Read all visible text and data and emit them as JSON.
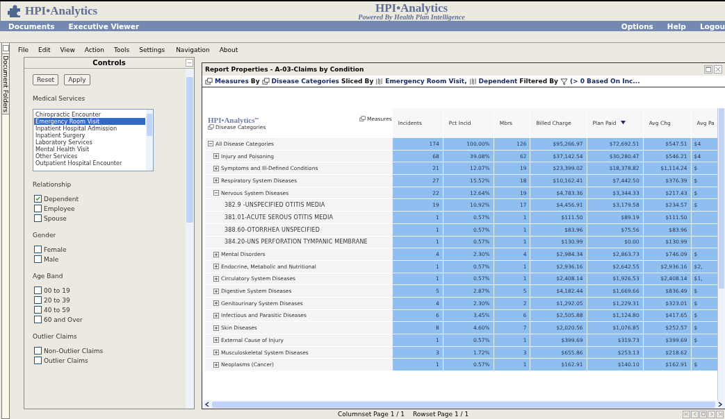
{
  "header": {
    "logo": "HPI•Analytics",
    "title": "HPI•Analytics",
    "subtitle": "Powered By Health Plan Intelligence"
  },
  "nav_left": [
    "Documents",
    "Executive Viewer"
  ],
  "nav_right": [
    "Options",
    "Help",
    "Logou"
  ],
  "side_tab": "Document Folders",
  "menu": [
    "File",
    "Edit",
    "View",
    "Action",
    "Tools",
    "Settings",
    "Navigation",
    "About"
  ],
  "controls": {
    "title": "Controls",
    "buttons": [
      "Reset",
      "Apply"
    ],
    "medical_services": {
      "label": "Medical Services",
      "items": [
        {
          "text": "Chiropractic Encounter",
          "selected": false
        },
        {
          "text": "Emergency Room Visit",
          "selected": true
        },
        {
          "text": "Inpatient Hospital Admission",
          "selected": false
        },
        {
          "text": "Inpatient Surgery",
          "selected": false
        },
        {
          "text": "Laboratory Services",
          "selected": false
        },
        {
          "text": "Mental Health Visit",
          "selected": false
        },
        {
          "text": "Other Services",
          "selected": false
        },
        {
          "text": "Outpatient Hospital Encounter",
          "selected": false
        }
      ]
    },
    "groups": [
      {
        "label": "Relationship",
        "options": [
          {
            "text": "Dependent",
            "checked": true
          },
          {
            "text": "Employee",
            "checked": false
          },
          {
            "text": "Spouse",
            "checked": false
          }
        ]
      },
      {
        "label": "Gender",
        "options": [
          {
            "text": "Female",
            "checked": false
          },
          {
            "text": "Male",
            "checked": false
          }
        ]
      },
      {
        "label": "Age Band",
        "options": [
          {
            "text": "00 to 19",
            "checked": false
          },
          {
            "text": "20 to 39",
            "checked": false
          },
          {
            "text": "40 to 59",
            "checked": false
          },
          {
            "text": "60 and Over",
            "checked": false
          }
        ]
      },
      {
        "label": "Outlier Claims",
        "options": [
          {
            "text": "Non-Outlier Claims",
            "checked": false
          },
          {
            "text": "Outlier Claims",
            "checked": false
          }
        ]
      }
    ]
  },
  "report": {
    "title": "Report Properties - A-03-Claims by Condition",
    "breadcrumb": [
      {
        "kind": "icon-link",
        "text": "Measures"
      },
      {
        "kind": "plain",
        "text": "By"
      },
      {
        "kind": "icon-link",
        "text": "Disease Categories"
      },
      {
        "kind": "plain",
        "text": "Sliced By"
      },
      {
        "kind": "slice-link",
        "text": "Emergency Room Visit,"
      },
      {
        "kind": "slice-link",
        "text": "Dependent"
      },
      {
        "kind": "plain",
        "text": "Filtered By"
      },
      {
        "kind": "filter-link",
        "text": "(> 0 Based On Inc..."
      }
    ],
    "corner": {
      "logo": "HPI•Analytics",
      "mark": "tm",
      "measures": "Measures",
      "rows": "Disease Categories"
    },
    "columns": [
      {
        "label": "Incidents"
      },
      {
        "label": "Pct Incid"
      },
      {
        "label": "Mbrs"
      },
      {
        "label": "Billed Charge"
      },
      {
        "label": "Plan Paid",
        "sorted": true
      },
      {
        "label": "Avg Chg"
      },
      {
        "label": "Avg Pa"
      }
    ],
    "rows": [
      {
        "label": "All Disease Categories",
        "expanded": true,
        "values": [
          "174",
          "100.00%",
          "126",
          "$95,266.97",
          "$72,692.51",
          "$547.51",
          "$4"
        ],
        "children": [
          {
            "label": "Injury and Poisoning",
            "expanded": false,
            "values": [
              "68",
              "39.08%",
              "62",
              "$37,142.54",
              "$30,280.47",
              "$546.21",
              "$4"
            ]
          },
          {
            "label": "Symptoms and Ill-Defined Conditions",
            "expanded": false,
            "values": [
              "21",
              "12.07%",
              "19",
              "$23,399.02",
              "$18,378.82",
              "$1,114.24",
              "$"
            ]
          },
          {
            "label": "Respiratory System Diseases",
            "expanded": false,
            "values": [
              "27",
              "15.52%",
              "18",
              "$10,162.41",
              "$7,442.50",
              "$376.39",
              "$"
            ]
          },
          {
            "label": "Nervous System Diseases",
            "expanded": true,
            "values": [
              "22",
              "12.64%",
              "19",
              "$4,783.36",
              "$3,344.33",
              "$217.43",
              "$"
            ],
            "children": [
              {
                "label": "382.9 -UNSPECIFIED OTITIS MEDIA",
                "values": [
                  "19",
                  "10.92%",
                  "17",
                  "$4,456.91",
                  "$3,179.58",
                  "$234.57",
                  "$"
                ]
              },
              {
                "label": "381.01-ACUTE SEROUS OTITIS MEDIA",
                "values": [
                  "1",
                  "0.57%",
                  "1",
                  "$111.50",
                  "$89.19",
                  "$111.50"
                ]
              },
              {
                "label": "388.60-OTORRHEA UNSPECIFIED",
                "values": [
                  "1",
                  "0.57%",
                  "1",
                  "$83.96",
                  "$75.56",
                  "$83.96"
                ]
              },
              {
                "label": "384.20-UNS PERFORATION TYMPANIC MEMBRANE",
                "values": [
                  "1",
                  "0.57%",
                  "1",
                  "$130.99",
                  "$0.00",
                  "$130.99"
                ]
              }
            ]
          },
          {
            "label": "Mental Disorders",
            "expanded": false,
            "values": [
              "4",
              "2.30%",
              "4",
              "$2,984.34",
              "$2,863.73",
              "$746.09",
              "$"
            ]
          },
          {
            "label": "Endocrine, Metabolic and Nutritional",
            "expanded": false,
            "values": [
              "1",
              "0.57%",
              "1",
              "$2,936.16",
              "$2,642.55",
              "$2,936.16",
              "$2,"
            ]
          },
          {
            "label": "Circulatory System Diseases",
            "expanded": false,
            "values": [
              "1",
              "0.57%",
              "1",
              "$2,408.14",
              "$1,926.53",
              "$2,408.14",
              "$1,"
            ]
          },
          {
            "label": "Digestive System Diseases",
            "expanded": false,
            "values": [
              "5",
              "2.87%",
              "5",
              "$4,182.44",
              "$1,669.66",
              "$836.49",
              "$"
            ]
          },
          {
            "label": "Genitourinary System Diseases",
            "expanded": false,
            "values": [
              "4",
              "2.30%",
              "2",
              "$1,292.05",
              "$1,229.31",
              "$323.01",
              "$"
            ]
          },
          {
            "label": "Infectious and Parasitic Diseases",
            "expanded": false,
            "values": [
              "6",
              "3.45%",
              "6",
              "$2,505.88",
              "$1,124.80",
              "$417.65",
              "$"
            ]
          },
          {
            "label": "Skin Diseases",
            "expanded": false,
            "values": [
              "8",
              "4.60%",
              "7",
              "$2,020.56",
              "$1,076.85",
              "$252.57",
              "$"
            ]
          },
          {
            "label": "External Cause of Injury",
            "expanded": false,
            "values": [
              "1",
              "0.57%",
              "1",
              "$399.69",
              "$319.73",
              "$399.69",
              "$"
            ]
          },
          {
            "label": "Musculoskeletal System Diseases",
            "expanded": false,
            "values": [
              "3",
              "1.72%",
              "3",
              "$655.86",
              "$253.13",
              "$218.62"
            ]
          },
          {
            "label": "Neoplasms (Cancer)",
            "expanded": false,
            "values": [
              "1",
              "0.57%",
              "1",
              "$162.91",
              "$140.10",
              "$162.91",
              "$"
            ]
          }
        ]
      }
    ]
  },
  "footer": {
    "columnset": "Columnset Page 1 / 1",
    "rowset": "Rowset Page 1 / 1"
  }
}
